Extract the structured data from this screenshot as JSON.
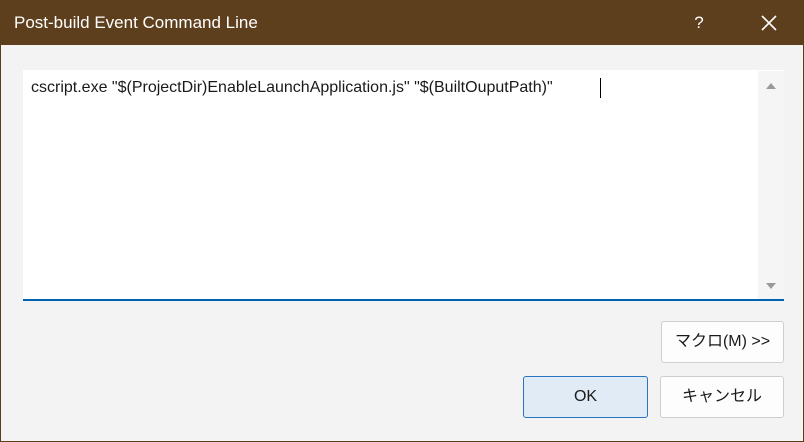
{
  "window": {
    "title": "Post-build Event Command Line",
    "help_label": "?"
  },
  "editor": {
    "value": "cscript.exe \"$(ProjectDir)EnableLaunchApplication.js\" \"$(BuiltOuputPath)\""
  },
  "buttons": {
    "macros_label": "マクロ(M) >>",
    "ok_label": "OK",
    "cancel_label": "キャンセル"
  },
  "colors": {
    "titlebar": "#5e3f1d",
    "accent": "#0063b1",
    "ok_background": "#e0ebf6"
  },
  "icons": {
    "help": "help-icon",
    "close": "close-icon",
    "scroll_up": "scroll-up-arrow-icon",
    "scroll_down": "scroll-down-arrow-icon"
  }
}
